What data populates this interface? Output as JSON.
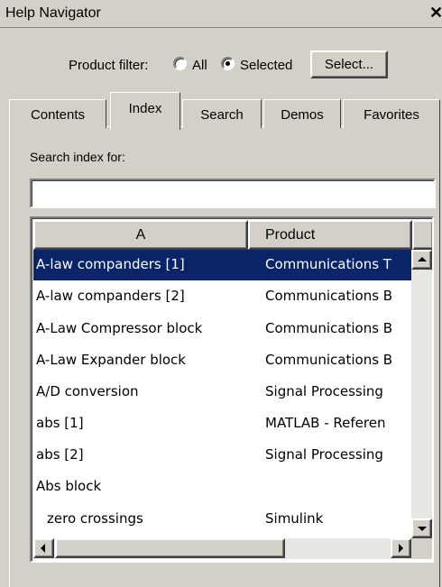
{
  "window": {
    "title": "Help Navigator",
    "close_label": "✕"
  },
  "filter": {
    "label": "Product filter:",
    "option_all": "All",
    "option_selected": "Selected",
    "selected_value": "Selected",
    "select_button": "Select..."
  },
  "tabs": [
    {
      "label": "Contents"
    },
    {
      "label": "Index",
      "active": true
    },
    {
      "label": "Search"
    },
    {
      "label": "Demos"
    },
    {
      "label": "Favorites"
    }
  ],
  "search": {
    "label": "Search index for:",
    "value": "",
    "placeholder": ""
  },
  "table": {
    "columns": [
      "A",
      "Product"
    ],
    "rows": [
      {
        "term": "A-law companders [1]",
        "product": "Communications T",
        "selected": true
      },
      {
        "term": "A-law companders [2]",
        "product": "Communications B"
      },
      {
        "term": "A-Law Compressor block",
        "product": "Communications B"
      },
      {
        "term": "A-Law Expander block",
        "product": "Communications B"
      },
      {
        "term": "A/D conversion",
        "product": "Signal Processing"
      },
      {
        "term": "abs [1]",
        "product": "MATLAB - Referen"
      },
      {
        "term": "abs [2]",
        "product": "Signal Processing"
      },
      {
        "term": "Abs block",
        "product": ""
      },
      {
        "term": "zero crossings",
        "product": "Simulink",
        "indent": true
      }
    ]
  },
  "colors": {
    "selection": "#0a246a",
    "window_bg": "#d4d0c8"
  }
}
